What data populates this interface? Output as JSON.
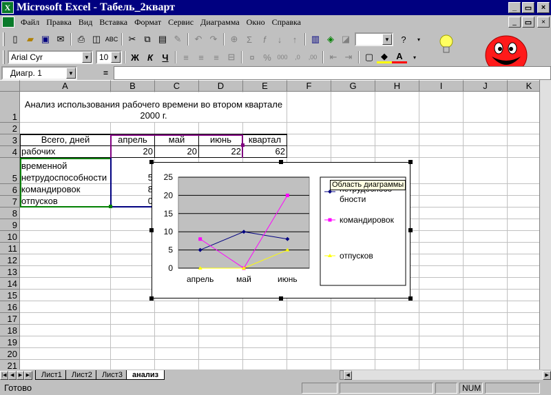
{
  "window": {
    "title": "Microsoft Excel - Табель_2кварт",
    "min": "_",
    "restore": "▭",
    "close": "×"
  },
  "menu": [
    "Файл",
    "Правка",
    "Вид",
    "Вставка",
    "Формат",
    "Сервис",
    "Диаграмма",
    "Окно",
    "Справка"
  ],
  "format_toolbar": {
    "font": "Arial Cyr",
    "size": "10",
    "bold": "Ж",
    "italic": "К",
    "underline": "Ч",
    "percent": "%",
    "thousands": "000"
  },
  "formula": {
    "name_box": "Диагр. 1",
    "equals": "="
  },
  "columns": [
    "A",
    "B",
    "C",
    "D",
    "E",
    "F",
    "G",
    "H",
    "I",
    "J",
    "K"
  ],
  "rows": [
    "1",
    "2",
    "3",
    "4",
    "5",
    "6",
    "7",
    "8",
    "9",
    "10",
    "11",
    "12",
    "13",
    "14",
    "15",
    "16",
    "17",
    "18",
    "19",
    "20",
    "21"
  ],
  "sheet": {
    "title_line1": "Анализ использования рабочего времени во втором квартале",
    "title_line2": "2000 г.",
    "headers": {
      "a3": "Всего, дней",
      "b3": "апрель",
      "c3": "май",
      "d3": "июнь",
      "e3": "квартал"
    },
    "r4": {
      "a": "рабочих",
      "b": "20",
      "c": "20",
      "d": "22",
      "e": "62"
    },
    "r5": {
      "a1": "временной",
      "a2": "нетрудоспособности",
      "b": "5"
    },
    "r6": {
      "a": "командировок",
      "b": "8"
    },
    "r7": {
      "a": "отпусков",
      "b": "0"
    }
  },
  "chart_data": {
    "type": "line",
    "categories": [
      "апрель",
      "май",
      "июнь"
    ],
    "yticks": [
      "25",
      "20",
      "15",
      "10",
      "5",
      "0"
    ],
    "ylim": [
      0,
      25
    ],
    "series": [
      {
        "name": "временной нетрудоспособности",
        "legend_text": "нетрудоспосо бности",
        "values": [
          5,
          10,
          8
        ],
        "color": "#000080"
      },
      {
        "name": "командировок",
        "values": [
          8,
          0,
          20
        ],
        "color": "#ff00ff"
      },
      {
        "name": "отпусков",
        "values": [
          0,
          0,
          5
        ],
        "color": "#ffff00"
      }
    ],
    "plot_background": "#c0c0c0",
    "grid": true,
    "legend_position": "right",
    "tooltip": "Область диаграммы"
  },
  "tabs": [
    "Лист1",
    "Лист2",
    "Лист3",
    "анализ"
  ],
  "active_tab": "анализ",
  "status": {
    "text": "Готово",
    "num": "NUM"
  }
}
